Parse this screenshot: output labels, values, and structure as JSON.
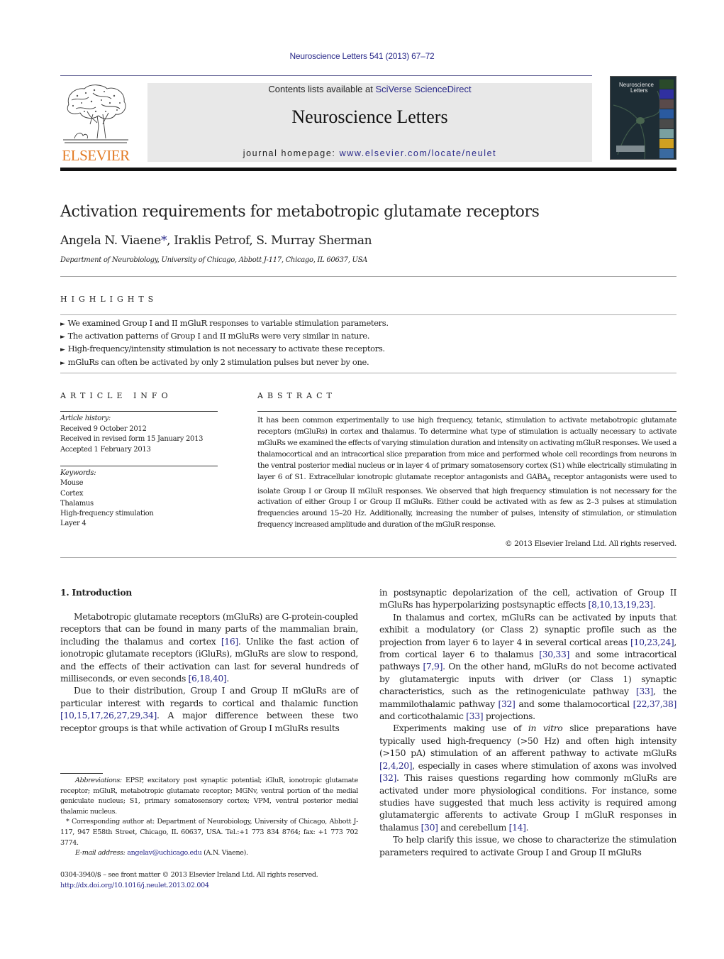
{
  "journal_ref": "Neuroscience Letters 541 (2013) 67–72",
  "publisher": {
    "logo_wordmark": "ELSEVIER",
    "logo_icon": "elsevier-tree-icon",
    "brand_color": "#e37b24"
  },
  "header": {
    "contents_prefix": "Contents lists available at ",
    "contents_link": "SciVerse ScienceDirect",
    "journal_title": "Neuroscience Letters",
    "homepage_prefix": "journal homepage: ",
    "homepage_link": "www.elsevier.com/locate/neulet",
    "header_bg": "#e8e8e8",
    "link_color": "#2a2a8a"
  },
  "cover": {
    "title_line1": "Neuroscience",
    "title_line2": "Letters"
  },
  "article": {
    "title": "Activation requirements for metabotropic glutamate receptors",
    "authors": [
      {
        "name": "Angela N. Viaene",
        "mark": "*"
      },
      {
        "name": "Iraklis Petrof"
      },
      {
        "name": "S. Murray Sherman"
      }
    ],
    "affiliation": "Department of Neurobiology, University of Chicago, Abbott J-117, Chicago, IL 60637, USA"
  },
  "highlights": {
    "heading": "HIGHLIGHTS",
    "items": [
      "We examined Group I and II mGluR responses to variable stimulation parameters.",
      "The activation patterns of Group I and II mGluRs were very similar in nature.",
      "High-frequency/intensity stimulation is not necessary to activate these receptors.",
      "mGluRs can often be activated by only 2 stimulation pulses but never by one."
    ]
  },
  "article_info": {
    "heading": "ARTICLE INFO",
    "history_label": "Article history:",
    "history": [
      "Received 9 October 2012",
      "Received in revised form 15 January 2013",
      "Accepted 1 February 2013"
    ],
    "keywords_label": "Keywords:",
    "keywords": [
      "Mouse",
      "Cortex",
      "Thalamus",
      "High-frequency stimulation",
      "Layer 4"
    ]
  },
  "abstract": {
    "heading": "ABSTRACT",
    "text_part1": "It has been common experimentally to use high frequency, tetanic, stimulation to activate metabotropic glutamate receptors (mGluRs) in cortex and thalamus. To determine what type of stimulation is actually necessary to activate mGluRs we examined the effects of varying stimulation duration and intensity on activating mGluR responses. We used a thalamocortical and an intracortical slice preparation from mice and performed whole cell recordings from neurons in the ventral posterior medial nucleus or in layer 4 of primary somatosensory cortex (S1) while electrically stimulating in layer 6 of S1. Extracellular ionotropic glutamate receptor antagonists and GABA",
    "subscript": "A",
    "text_part2": " receptor antagonists were used to isolate Group I or Group II mGluR responses. We observed that high frequency stimulation is not necessary for the activation of either Group I or Group II mGluRs. Either could be activated with as few as 2–3 pulses at stimulation frequencies around 15–20 Hz. Additionally, increasing the number of pulses, intensity of stimulation, or stimulation frequency increased amplitude and duration of the mGluR response.",
    "copyright": "© 2013 Elsevier Ireland Ltd. All rights reserved."
  },
  "introduction": {
    "heading": "1.  Introduction",
    "left_paragraphs": [
      [
        {
          "t": "Metabotropic glutamate receptors (mGluRs) are G-protein-coupled receptors that can be found in many parts of the mammalian brain, including the thalamus and cortex "
        },
        {
          "c": "[16]"
        },
        {
          "t": ". Unlike the fast action of ionotropic glutamate receptors (iGluRs), mGluRs are slow to respond, and the effects of their activation can last for several hundreds of milliseconds, or even seconds "
        },
        {
          "c": "[6,18,40]"
        },
        {
          "t": "."
        }
      ],
      [
        {
          "t": "Due to their distribution, Group I and Group II mGluRs are of particular interest with regards to cortical and thalamic function "
        },
        {
          "c": "[10,15,17,26,27,29,34]"
        },
        {
          "t": ". A major difference between these two receptor groups is that while activation of Group I mGluRs results"
        }
      ]
    ],
    "right_paragraphs": [
      [
        {
          "t": "in postsynaptic depolarization of the cell, activation of Group II mGluRs has hyperpolarizing postsynaptic effects "
        },
        {
          "c": "[8,10,13,19,23]"
        },
        {
          "t": "."
        }
      ],
      [
        {
          "t": "In thalamus and cortex, mGluRs can be activated by inputs that exhibit a modulatory (or Class 2) synaptic profile such as the projection from layer 6 to layer 4 in several cortical areas "
        },
        {
          "c": "[10,23,24]"
        },
        {
          "t": ", from cortical layer 6 to thalamus "
        },
        {
          "c": "[30,33]"
        },
        {
          "t": " and some intracortical pathways "
        },
        {
          "c": "[7,9]"
        },
        {
          "t": ". On the other hand, mGluRs do not become activated by glutamatergic inputs with driver (or Class 1) synaptic characteristics, such as the retinogeniculate pathway "
        },
        {
          "c": "[33]"
        },
        {
          "t": ", the mammilothalamic pathway "
        },
        {
          "c": "[32]"
        },
        {
          "t": " and some thalamocortical "
        },
        {
          "c": "[22,37,38]"
        },
        {
          "t": " and corticothalamic "
        },
        {
          "c": "[33]"
        },
        {
          "t": " projections."
        }
      ],
      [
        {
          "t": "Experiments making use of "
        },
        {
          "i": "in vitro"
        },
        {
          "t": " slice preparations have typically used high-frequency (>50 Hz) and often high intensity (>150 pA) stimulation of an afferent pathway to activate mGluRs "
        },
        {
          "c": "[2,4,20]"
        },
        {
          "t": ", especially in cases where stimulation of axons was involved "
        },
        {
          "c": "[32]"
        },
        {
          "t": ". This raises questions regarding how commonly mGluRs are activated under more physiological conditions. For instance, some studies have suggested that much less activity is required among glutamatergic afferents to activate Group I mGluR responses in thalamus "
        },
        {
          "c": "[30]"
        },
        {
          "t": " and cerebellum "
        },
        {
          "c": "[14]"
        },
        {
          "t": "."
        }
      ],
      [
        {
          "t": "To help clarify this issue, we chose to characterize the stimulation parameters required to activate Group I and Group II mGluRs"
        }
      ]
    ]
  },
  "footnotes": {
    "abbrev_label": "Abbreviations:",
    "abbrev_text": " EPSP, excitatory post synaptic potential; iGluR, ionotropic glutamate receptor; mGluR, metabotropic glutamate receptor; MGNv, ventral portion of the medial geniculate nucleus; S1, primary somatosensory cortex; VPM, ventral posterior medial thalamic nucleus.",
    "corresponding": "* Corresponding author at: Department of Neurobiology, University of Chicago, Abbott J-117, 947 E58th Street, Chicago, IL 60637, USA. Tel.:+1 773 834 8764; fax: +1 773 702 3774.",
    "email_label": "E-mail address:",
    "email": "angelav@uchicago.edu",
    "email_suffix": " (A.N. Viaene).",
    "front_matter": "0304-3940/$ – see front matter © 2013 Elsevier Ireland Ltd. All rights reserved.",
    "doi": "http://dx.doi.org/10.1016/j.neulet.2013.02.004"
  }
}
